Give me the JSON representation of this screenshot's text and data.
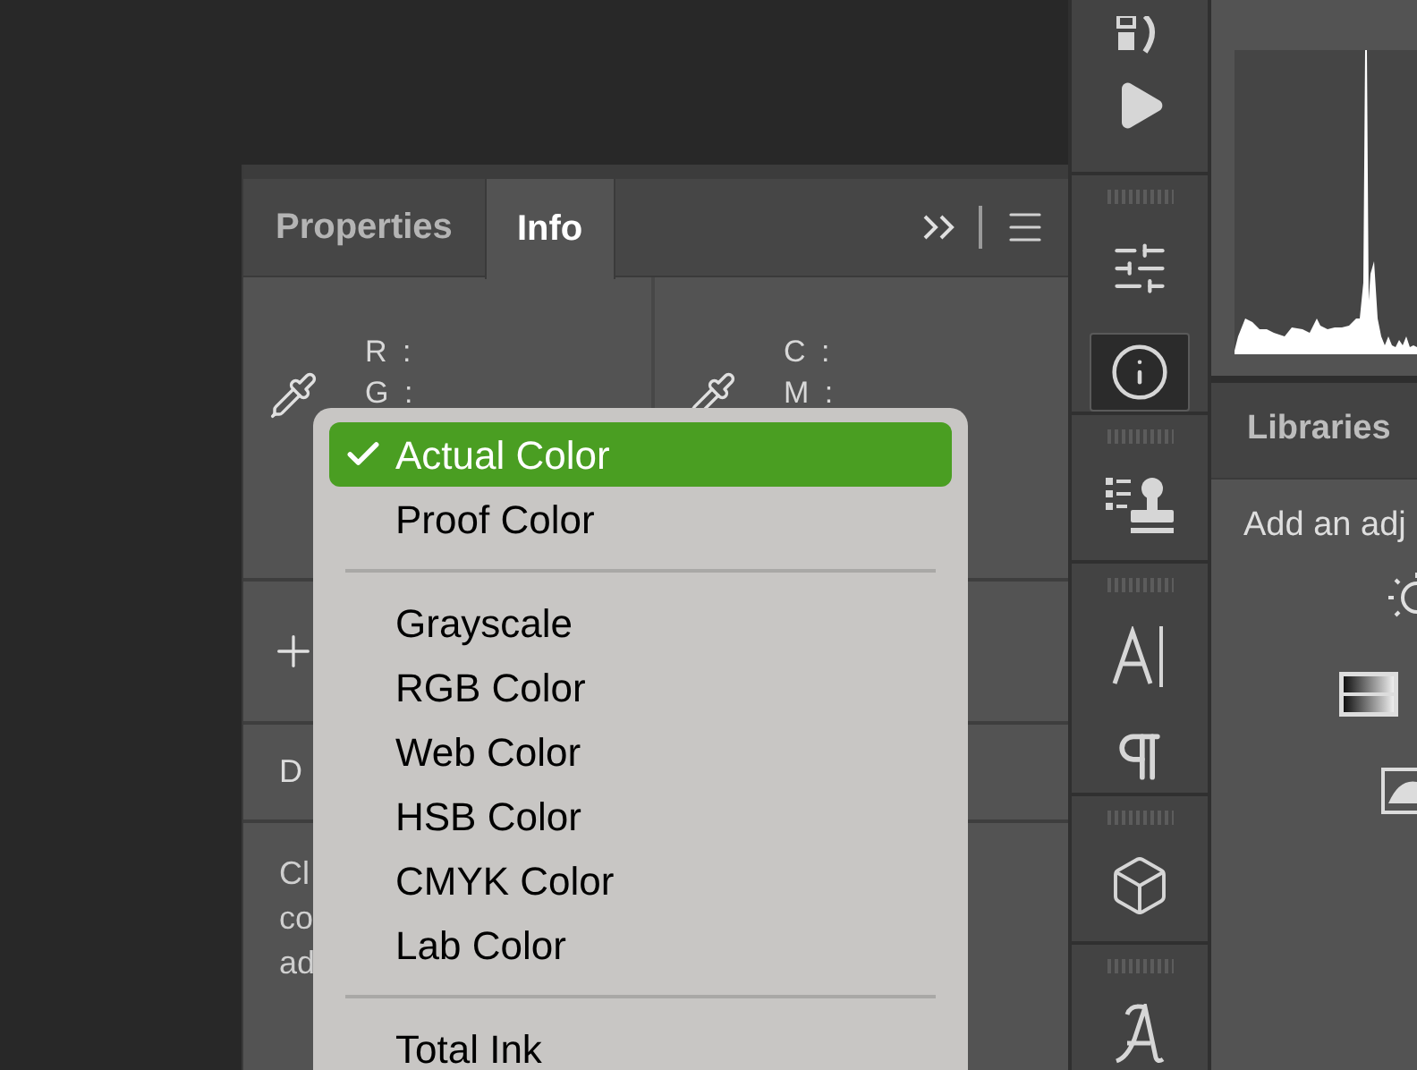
{
  "info_panel": {
    "tabs": [
      {
        "label": "Properties",
        "selected": false
      },
      {
        "label": "Info",
        "selected": true
      }
    ],
    "readouts": [
      {
        "lines": [
          "R :",
          "G :"
        ]
      },
      {
        "lines": [
          "C :",
          "M :"
        ]
      }
    ],
    "section_header": "D",
    "description_lines": [
      "Cl",
      "co",
      "ad"
    ]
  },
  "menu": {
    "items": [
      {
        "kind": "item",
        "label": "Actual Color",
        "checked": true,
        "selected": true
      },
      {
        "kind": "item",
        "label": "Proof Color",
        "checked": false,
        "selected": false
      },
      {
        "kind": "separator"
      },
      {
        "kind": "item",
        "label": "Grayscale",
        "checked": false,
        "selected": false
      },
      {
        "kind": "item",
        "label": "RGB Color",
        "checked": false,
        "selected": false
      },
      {
        "kind": "item",
        "label": "Web Color",
        "checked": false,
        "selected": false
      },
      {
        "kind": "item",
        "label": "HSB Color",
        "checked": false,
        "selected": false
      },
      {
        "kind": "item",
        "label": "CMYK Color",
        "checked": false,
        "selected": false
      },
      {
        "kind": "item",
        "label": "Lab Color",
        "checked": false,
        "selected": false
      },
      {
        "kind": "separator"
      },
      {
        "kind": "item",
        "label": "Total Ink",
        "checked": false,
        "selected": false
      }
    ]
  },
  "toolbar": [
    {
      "tools": [
        {
          "kind": "tracks",
          "selected": false
        },
        {
          "kind": "play",
          "selected": false
        }
      ]
    },
    {
      "tools": [
        {
          "kind": "sliders",
          "selected": false
        },
        {
          "kind": "info",
          "selected": true
        }
      ]
    },
    {
      "tools": [
        {
          "kind": "stamp",
          "selected": false
        }
      ]
    },
    {
      "tools": [
        {
          "kind": "character",
          "selected": false
        },
        {
          "kind": "paragraph",
          "selected": false
        }
      ]
    },
    {
      "tools": [
        {
          "kind": "cube",
          "selected": false
        }
      ]
    },
    {
      "tools": [
        {
          "kind": "glyph",
          "selected": false
        }
      ]
    }
  ],
  "libraries_panel": {
    "tab": "Libraries",
    "text": "Add an adj"
  }
}
